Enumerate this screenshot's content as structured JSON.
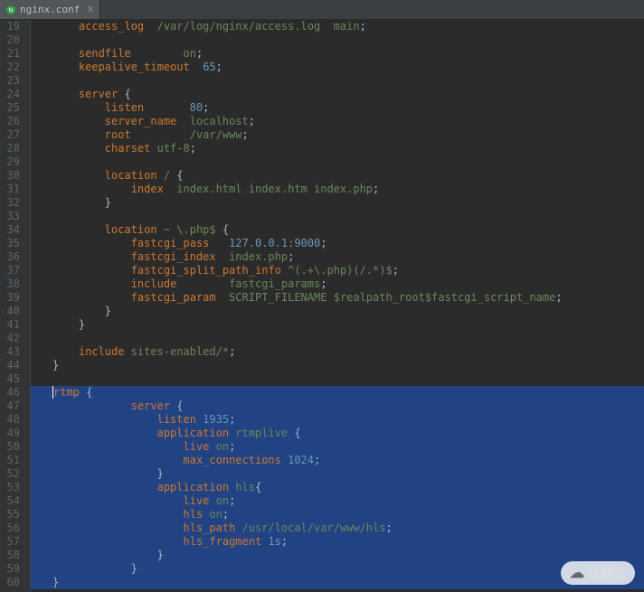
{
  "tab": {
    "label": "nginx.conf"
  },
  "watermark": {
    "text": "亿速云"
  },
  "gutter_start": 19,
  "lines": [
    {
      "n": 19,
      "sel": false,
      "tokens": [
        [
          "    ",
          ""
        ],
        [
          "access_log  ",
          "dir"
        ],
        [
          "/var/log/nginx/access.log  main",
          "str"
        ],
        [
          ";",
          "sym"
        ]
      ]
    },
    {
      "n": 20,
      "sel": false,
      "tokens": [
        [
          "",
          "sym"
        ]
      ]
    },
    {
      "n": 21,
      "sel": false,
      "tokens": [
        [
          "    ",
          ""
        ],
        [
          "sendfile        ",
          "dir"
        ],
        [
          "on",
          "str"
        ],
        [
          ";",
          "sym"
        ]
      ]
    },
    {
      "n": 22,
      "sel": false,
      "tokens": [
        [
          "    ",
          ""
        ],
        [
          "keepalive_timeout  ",
          "dir"
        ],
        [
          "65",
          "num"
        ],
        [
          ";",
          "sym"
        ]
      ]
    },
    {
      "n": 23,
      "sel": false,
      "tokens": [
        [
          "",
          "sym"
        ]
      ]
    },
    {
      "n": 24,
      "sel": false,
      "tokens": [
        [
          "    ",
          ""
        ],
        [
          "server ",
          "dir"
        ],
        [
          "{",
          "sym"
        ]
      ]
    },
    {
      "n": 25,
      "sel": false,
      "tokens": [
        [
          "        ",
          ""
        ],
        [
          "listen       ",
          "dir"
        ],
        [
          "80",
          "num"
        ],
        [
          ";",
          "sym"
        ]
      ]
    },
    {
      "n": 26,
      "sel": false,
      "tokens": [
        [
          "        ",
          ""
        ],
        [
          "server_name  ",
          "dir"
        ],
        [
          "localhost",
          "str"
        ],
        [
          ";",
          "sym"
        ]
      ]
    },
    {
      "n": 27,
      "sel": false,
      "tokens": [
        [
          "        ",
          ""
        ],
        [
          "root         ",
          "dir"
        ],
        [
          "/var/www",
          "str"
        ],
        [
          ";",
          "sym"
        ]
      ]
    },
    {
      "n": 28,
      "sel": false,
      "tokens": [
        [
          "        ",
          ""
        ],
        [
          "charset ",
          "dir"
        ],
        [
          "utf-8",
          "str"
        ],
        [
          ";",
          "sym"
        ]
      ]
    },
    {
      "n": 29,
      "sel": false,
      "tokens": [
        [
          "",
          "sym"
        ]
      ]
    },
    {
      "n": 30,
      "sel": false,
      "tokens": [
        [
          "        ",
          ""
        ],
        [
          "location ",
          "dir"
        ],
        [
          "/ ",
          "str"
        ],
        [
          "{",
          "sym"
        ]
      ]
    },
    {
      "n": 31,
      "sel": false,
      "tokens": [
        [
          "            ",
          ""
        ],
        [
          "index  ",
          "dir"
        ],
        [
          "index.html index.htm index.php",
          "str"
        ],
        [
          ";",
          "sym"
        ]
      ]
    },
    {
      "n": 32,
      "sel": false,
      "tokens": [
        [
          "        ",
          ""
        ],
        [
          "}",
          "sym"
        ]
      ]
    },
    {
      "n": 33,
      "sel": false,
      "tokens": [
        [
          "",
          "sym"
        ]
      ]
    },
    {
      "n": 34,
      "sel": false,
      "tokens": [
        [
          "        ",
          ""
        ],
        [
          "location ",
          "dir"
        ],
        [
          "~ \\.php$ ",
          "str"
        ],
        [
          "{",
          "sym"
        ]
      ]
    },
    {
      "n": 35,
      "sel": false,
      "tokens": [
        [
          "            ",
          ""
        ],
        [
          "fastcgi_pass   ",
          "dir"
        ],
        [
          "127.0.0.1:9000",
          "num"
        ],
        [
          ";",
          "sym"
        ]
      ]
    },
    {
      "n": 36,
      "sel": false,
      "tokens": [
        [
          "            ",
          ""
        ],
        [
          "fastcgi_index  ",
          "dir"
        ],
        [
          "index.php",
          "str"
        ],
        [
          ";",
          "sym"
        ]
      ]
    },
    {
      "n": 37,
      "sel": false,
      "tokens": [
        [
          "            ",
          ""
        ],
        [
          "fastcgi_split_path_info ",
          "dir"
        ],
        [
          "^(.+\\.php)(/.*)$",
          "str"
        ],
        [
          ";",
          "sym"
        ]
      ]
    },
    {
      "n": 38,
      "sel": false,
      "tokens": [
        [
          "            ",
          ""
        ],
        [
          "include        ",
          "dir"
        ],
        [
          "fastcgi_params",
          "str"
        ],
        [
          ";",
          "sym"
        ]
      ]
    },
    {
      "n": 39,
      "sel": false,
      "tokens": [
        [
          "            ",
          ""
        ],
        [
          "fastcgi_param  ",
          "dir"
        ],
        [
          "SCRIPT_FILENAME $realpath_root$fastcgi_script_name",
          "str"
        ],
        [
          ";",
          "sym"
        ]
      ]
    },
    {
      "n": 40,
      "sel": false,
      "tokens": [
        [
          "        ",
          ""
        ],
        [
          "}",
          "sym"
        ]
      ]
    },
    {
      "n": 41,
      "sel": false,
      "tokens": [
        [
          "    ",
          ""
        ],
        [
          "}",
          "sym"
        ]
      ]
    },
    {
      "n": 42,
      "sel": false,
      "tokens": [
        [
          "",
          "sym"
        ]
      ]
    },
    {
      "n": 43,
      "sel": false,
      "tokens": [
        [
          "    ",
          ""
        ],
        [
          "include ",
          "dir"
        ],
        [
          "sites-enabled/*",
          "str"
        ],
        [
          ";",
          "sym"
        ]
      ]
    },
    {
      "n": 44,
      "sel": false,
      "tokens": [
        [
          "}",
          "sym"
        ]
      ]
    },
    {
      "n": 45,
      "sel": false,
      "tokens": [
        [
          "",
          "sym"
        ]
      ]
    },
    {
      "n": 46,
      "sel": true,
      "tokens": [
        [
          "rtmp ",
          "dir"
        ],
        [
          "{",
          "sym"
        ]
      ]
    },
    {
      "n": 47,
      "sel": true,
      "tokens": [
        [
          "            ",
          ""
        ],
        [
          "server ",
          "dir"
        ],
        [
          "{",
          "sym"
        ]
      ]
    },
    {
      "n": 48,
      "sel": true,
      "tokens": [
        [
          "                ",
          ""
        ],
        [
          "listen ",
          "dir"
        ],
        [
          "1935",
          "num"
        ],
        [
          ";",
          "sym"
        ]
      ]
    },
    {
      "n": 49,
      "sel": true,
      "tokens": [
        [
          "                ",
          ""
        ],
        [
          "application ",
          "dir"
        ],
        [
          "rtmplive ",
          "str"
        ],
        [
          "{",
          "sym"
        ]
      ]
    },
    {
      "n": 50,
      "sel": true,
      "tokens": [
        [
          "                    ",
          ""
        ],
        [
          "live ",
          "dir"
        ],
        [
          "on",
          "str"
        ],
        [
          ";",
          "sym"
        ]
      ]
    },
    {
      "n": 51,
      "sel": true,
      "tokens": [
        [
          "                    ",
          ""
        ],
        [
          "max_connections ",
          "dir"
        ],
        [
          "1024",
          "num"
        ],
        [
          ";",
          "sym"
        ]
      ]
    },
    {
      "n": 52,
      "sel": true,
      "tokens": [
        [
          "                ",
          ""
        ],
        [
          "}",
          "sym"
        ]
      ]
    },
    {
      "n": 53,
      "sel": true,
      "tokens": [
        [
          "                ",
          ""
        ],
        [
          "application ",
          "dir"
        ],
        [
          "hls",
          "str"
        ],
        [
          "{",
          "sym"
        ]
      ]
    },
    {
      "n": 54,
      "sel": true,
      "tokens": [
        [
          "                    ",
          ""
        ],
        [
          "live ",
          "dir"
        ],
        [
          "on",
          "str"
        ],
        [
          ";",
          "sym"
        ]
      ]
    },
    {
      "n": 55,
      "sel": true,
      "tokens": [
        [
          "                    ",
          ""
        ],
        [
          "hls ",
          "dir"
        ],
        [
          "on",
          "str"
        ],
        [
          ";",
          "sym"
        ]
      ]
    },
    {
      "n": 56,
      "sel": true,
      "tokens": [
        [
          "                    ",
          ""
        ],
        [
          "hls_path ",
          "dir"
        ],
        [
          "/usr/local/var/www/hls",
          "str"
        ],
        [
          ";",
          "sym"
        ]
      ]
    },
    {
      "n": 57,
      "sel": true,
      "tokens": [
        [
          "                    ",
          ""
        ],
        [
          "hls_fragment ",
          "dir"
        ],
        [
          "1s",
          "num"
        ],
        [
          ";",
          "sym"
        ]
      ]
    },
    {
      "n": 58,
      "sel": true,
      "tokens": [
        [
          "                ",
          ""
        ],
        [
          "}",
          "sym"
        ]
      ]
    },
    {
      "n": 59,
      "sel": true,
      "tokens": [
        [
          "            ",
          ""
        ],
        [
          "}",
          "sym"
        ]
      ]
    },
    {
      "n": 60,
      "sel": true,
      "tokens": [
        [
          "}",
          "sym"
        ]
      ]
    }
  ]
}
